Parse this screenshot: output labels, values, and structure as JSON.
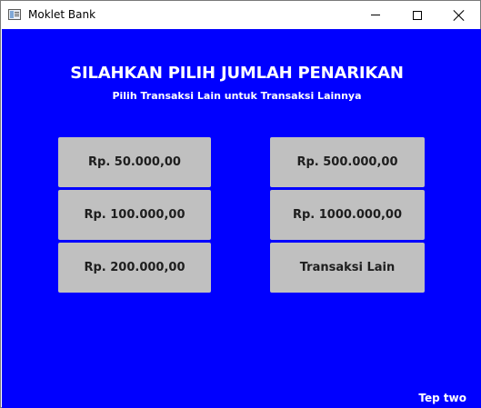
{
  "window": {
    "title": "Moklet Bank"
  },
  "header": {
    "title": "SILAHKAN PILIH JUMLAH PENARIKAN",
    "subtitle": "Pilih Transaksi Lain untuk Transaksi Lainnya"
  },
  "options": {
    "left": [
      "Rp. 50.000,00",
      "Rp. 100.000,00",
      "Rp. 200.000,00"
    ],
    "right": [
      "Rp. 500.000,00",
      "Rp. 1000.000,00",
      "Transaksi Lain"
    ]
  },
  "footer": {
    "text": "Tep two"
  },
  "colors": {
    "background": "#0000ff",
    "button": "#c0c0c0",
    "text_light": "#ffffff"
  }
}
